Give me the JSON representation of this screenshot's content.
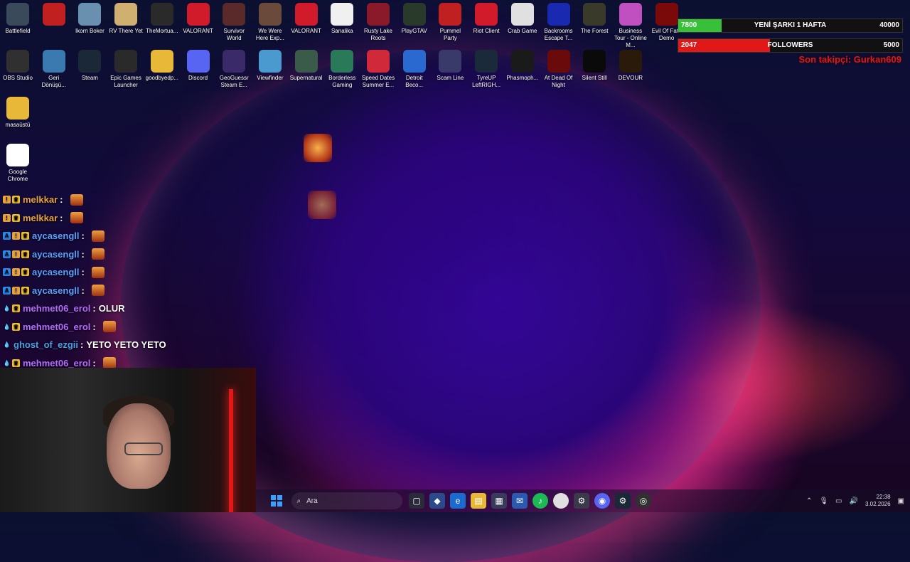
{
  "desktop_icons_row1": [
    {
      "label": "Battlefield",
      "color": "#3a4a5a"
    },
    {
      "label": "",
      "color": "#c02020"
    },
    {
      "label": "Ikorn Boker",
      "color": "#6a90b0"
    },
    {
      "label": "RV There Yet",
      "color": "#d0b070"
    },
    {
      "label": "TheMortua...",
      "color": "#2a2a2a"
    },
    {
      "label": "VALORANT",
      "color": "#d11a2a"
    },
    {
      "label": "Survivor World",
      "color": "#5a2a2a"
    },
    {
      "label": "We Were Here Exp...",
      "color": "#6a4a3a"
    },
    {
      "label": "VALORANT",
      "color": "#d11a2a"
    },
    {
      "label": "Sanalika",
      "color": "#f0f0f0"
    },
    {
      "label": "Rusty Lake Roots",
      "color": "#8a1a2a"
    },
    {
      "label": "PlayGTAV",
      "color": "#2a3a2a"
    },
    {
      "label": "Pummel Party",
      "color": "#c02020"
    },
    {
      "label": "Riot Client",
      "color": "#d11a2a"
    },
    {
      "label": "Crab Game",
      "color": "#e0e0e0"
    },
    {
      "label": "Backrooms Escape T...",
      "color": "#1a2ab0"
    },
    {
      "label": "The Forest",
      "color": "#3a3a2a"
    },
    {
      "label": "Business Tour - Online M...",
      "color": "#c050c0"
    },
    {
      "label": "Evil Of Fate Demo",
      "color": "#7a0a0a"
    }
  ],
  "desktop_icons_row2": [
    {
      "label": "OBS Studio",
      "color": "#303030"
    },
    {
      "label": "Geri Dönüşü...",
      "color": "#3a7ab0"
    },
    {
      "label": "Steam",
      "color": "#1b2838"
    },
    {
      "label": "Epic Games Launcher",
      "color": "#2a2a2a"
    },
    {
      "label": "goodbyedp...",
      "color": "#e8b838"
    },
    {
      "label": "Discord",
      "color": "#5865f2"
    },
    {
      "label": "GeoGuessr Steam E...",
      "color": "#3a2a6a"
    },
    {
      "label": "Viewfinder",
      "color": "#4a9ad0"
    },
    {
      "label": "Supernatural",
      "color": "#3a5a4a"
    },
    {
      "label": "Borderless Gaming",
      "color": "#2a7a5a"
    },
    {
      "label": "Speed Dates Summer E...",
      "color": "#d02a3a"
    },
    {
      "label": "Detroit Beco...",
      "color": "#2a6ad0"
    },
    {
      "label": "Scam Line",
      "color": "#3a3a6a"
    },
    {
      "label": "TyreUP LeftRIGH...",
      "color": "#1a2a3a"
    },
    {
      "label": "Phasmoph...",
      "color": "#1a1a1a"
    },
    {
      "label": "At Dead Of Night",
      "color": "#6a0a0a"
    },
    {
      "label": "Silent Still",
      "color": "#0a0a0a"
    },
    {
      "label": "DEVOUR",
      "color": "#2a1a0a"
    }
  ],
  "desktop_icons_col": [
    {
      "label": "masaüstü",
      "color": "#e8b838"
    },
    {
      "label": "Google Chrome",
      "color": "#ffffff"
    }
  ],
  "bars": {
    "song": {
      "current": "7800",
      "title": "YENİ ŞARKI 1 HAFTA",
      "goal": "40000",
      "progress": 0.195,
      "color": "#38c038"
    },
    "followers": {
      "current": "2047",
      "title": "FOLLOWERS",
      "goal": "5000",
      "progress": 0.41,
      "color": "#e01818"
    },
    "last_follower": "Son takipçi: Gurkan609"
  },
  "chat": [
    {
      "user": "melkkar",
      "color": "#e6a33a",
      "text": "",
      "emote": true,
      "badges": [
        "!",
        "♛"
      ]
    },
    {
      "user": "melkkar",
      "color": "#e6a33a",
      "text": "",
      "emote": true,
      "badges": [
        "!",
        "♛"
      ]
    },
    {
      "user": "aycasengll",
      "color": "#5aa0ff",
      "text": "",
      "emote": true,
      "badges": [
        "A",
        "!",
        "♛"
      ]
    },
    {
      "user": "aycasengll",
      "color": "#5aa0ff",
      "text": "",
      "emote": true,
      "badges": [
        "A",
        "!",
        "♛"
      ]
    },
    {
      "user": "aycasengll",
      "color": "#5aa0ff",
      "text": "",
      "emote": true,
      "badges": [
        "A",
        "!",
        "♛"
      ]
    },
    {
      "user": "aycasengll",
      "color": "#5aa0ff",
      "text": "",
      "emote": true,
      "badges": [
        "A",
        "!",
        "♛"
      ]
    },
    {
      "user": "mehmet06_erol",
      "color": "#b46cff",
      "text": "OLUR",
      "emote": false,
      "badges": [
        "💧",
        "♛"
      ]
    },
    {
      "user": "mehmet06_erol",
      "color": "#b46cff",
      "text": "",
      "emote": true,
      "badges": [
        "💧",
        "♛"
      ]
    },
    {
      "user": "ghost_of_ezgii",
      "color": "#4aa0e0",
      "text": "YETO YETO YETO",
      "emote": false,
      "badges": [
        "💧"
      ]
    },
    {
      "user": "mehmet06_erol",
      "color": "#b46cff",
      "text": "",
      "emote": true,
      "badges": [
        "💧",
        "♛"
      ]
    }
  ],
  "taskbar": {
    "search_label": "Ara",
    "time": "22:38",
    "date": "3.02.2026"
  }
}
